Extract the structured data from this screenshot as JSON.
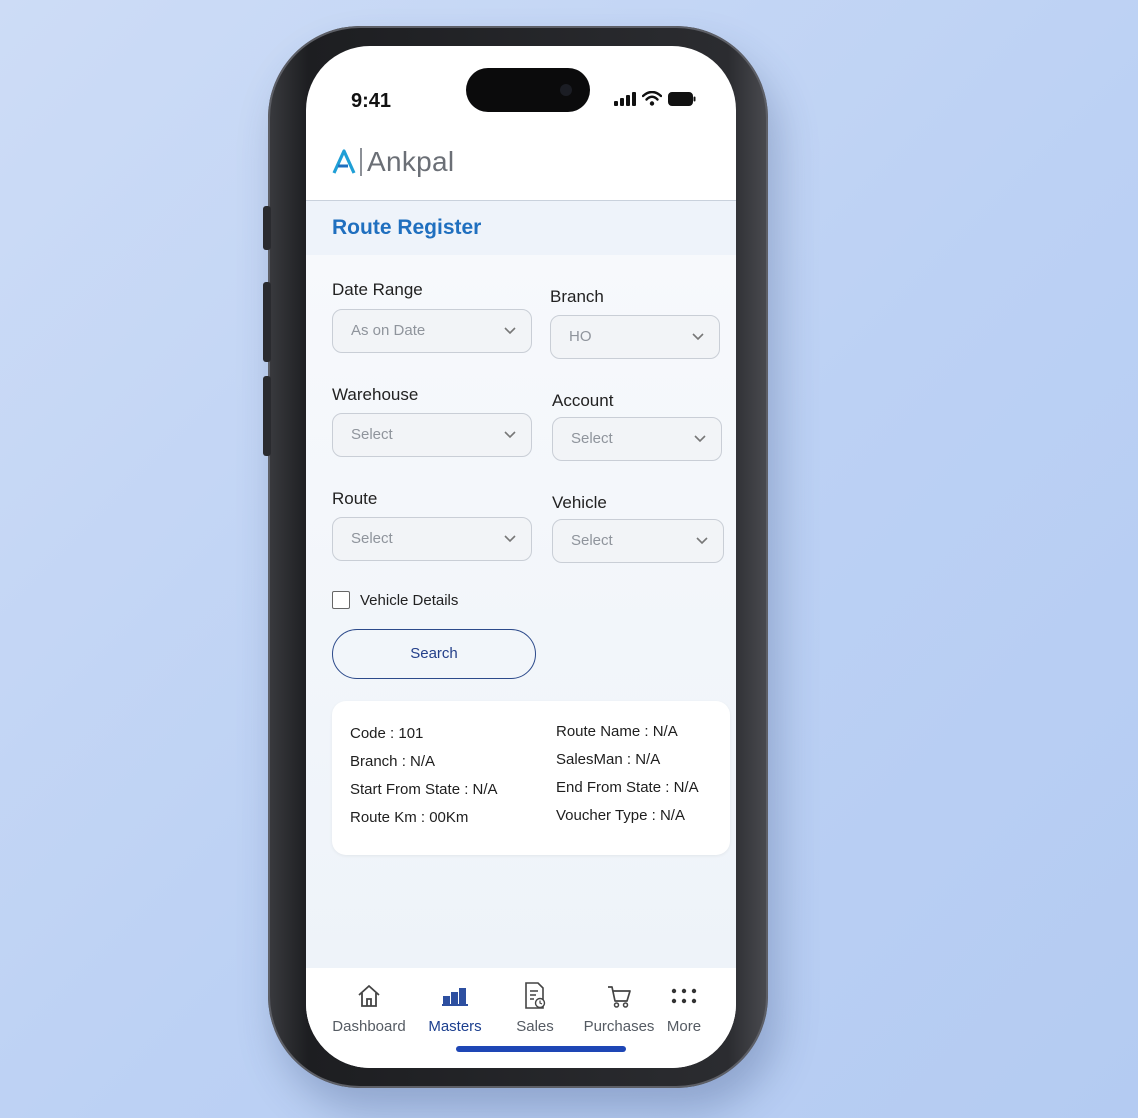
{
  "status_bar": {
    "time": "9:41"
  },
  "brand": {
    "name": "Ankpal",
    "accent": "#1f9fd6"
  },
  "page": {
    "title": "Route Register"
  },
  "filters": {
    "date_range": {
      "label": "Date Range",
      "value": "As on Date"
    },
    "branch": {
      "label": "Branch",
      "value": "HO"
    },
    "warehouse": {
      "label": "Warehouse",
      "value": "Select"
    },
    "account": {
      "label": "Account",
      "value": "Select"
    },
    "route": {
      "label": "Route",
      "value": "Select"
    },
    "vehicle": {
      "label": "Vehicle",
      "value": "Select"
    },
    "vehicle_details": {
      "label": "Vehicle Details",
      "checked": false
    },
    "search_label": "Search"
  },
  "result": {
    "left": [
      {
        "label": "Code :",
        "value": "101"
      },
      {
        "label": "Branch :",
        "value": "N/A"
      },
      {
        "label": "Start From State :",
        "value": "N/A"
      },
      {
        "label": "Route Km :",
        "value": "00Km"
      }
    ],
    "right": [
      {
        "label": "Route Name :",
        "value": "N/A"
      },
      {
        "label": "SalesMan :",
        "value": "N/A"
      },
      {
        "label": "End From State :",
        "value": "N/A"
      },
      {
        "label": "Voucher Type :",
        "value": "N/A"
      }
    ]
  },
  "bottom_nav": {
    "items": [
      {
        "label": "Dashboard",
        "icon": "home-icon"
      },
      {
        "label": "Masters",
        "icon": "masters-icon",
        "active": true
      },
      {
        "label": "Sales",
        "icon": "sales-document-icon"
      },
      {
        "label": "Purchases",
        "icon": "cart-icon"
      },
      {
        "label": "More",
        "icon": "more-dots-icon"
      }
    ]
  },
  "colors": {
    "title": "#1f6fbf",
    "active_nav": "#1c3f8f",
    "home_indicator": "#1e46b5"
  }
}
